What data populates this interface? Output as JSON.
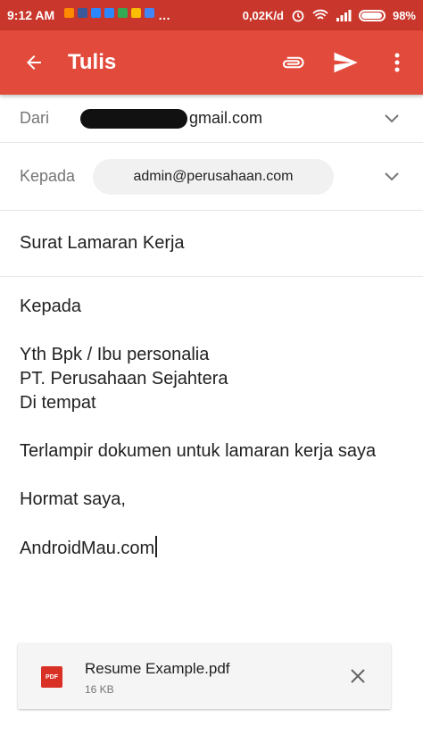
{
  "status_bar": {
    "time": "9:12 AM",
    "speed": "0,02K/d",
    "battery": "98%",
    "battery_level": 0.98,
    "notification_colors": [
      "#ff8a00",
      "#3b5998",
      "#2d88ff",
      "#2d88ff",
      "#34a853",
      "#fbbc05",
      "#4285f4"
    ]
  },
  "app_bar": {
    "title": "Tulis",
    "back_icon": "arrow-left-icon",
    "attach_icon": "paperclip-icon",
    "send_icon": "send-icon",
    "menu_icon": "more-vert-icon",
    "color": "#e24a3c"
  },
  "from": {
    "label": "Dari",
    "value_visible": "gmail.com"
  },
  "to": {
    "label": "Kepada",
    "recipient": "admin@perusahaan.com"
  },
  "subject": "Surat Lamaran Kerja",
  "body": {
    "greeting": "Kepada",
    "address": "Yth Bpk / Ibu personalia\nPT. Perusahaan Sejahtera\nDi tempat",
    "content": "Terlampir dokumen untuk lamaran kerja saya",
    "closing": "Hormat saya,",
    "signature": "AndroidMau.com"
  },
  "attachment": {
    "icon_label": "PDF",
    "name": "Resume Example.pdf",
    "size": "16 KB"
  }
}
